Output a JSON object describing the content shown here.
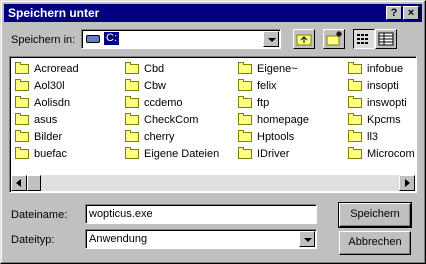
{
  "window": {
    "title": "Speichern unter",
    "help_btn": "?",
    "close_btn": "×"
  },
  "lookin": {
    "label": "Speichern in:",
    "value": "C:"
  },
  "files": [
    [
      "Acroread",
      "Cbd",
      "Eigene~",
      "infobue"
    ],
    [
      "Aol30l",
      "Cbw",
      "felix",
      "insopti"
    ],
    [
      "Aolisdn",
      "ccdemo",
      "ftp",
      "inswopti"
    ],
    [
      "asus",
      "CheckCom",
      "homepage",
      "Kpcms"
    ],
    [
      "Bilder",
      "cherry",
      "Hptools",
      "ll3"
    ],
    [
      "buefac",
      "Eigene Dateien",
      "IDriver",
      "Microcom"
    ]
  ],
  "filename": {
    "label": "Dateiname:",
    "value": "wopticus.exe"
  },
  "filetype": {
    "label": "Dateityp:",
    "value": "Anwendung"
  },
  "buttons": {
    "save": "Speichern",
    "cancel": "Abbrechen"
  }
}
